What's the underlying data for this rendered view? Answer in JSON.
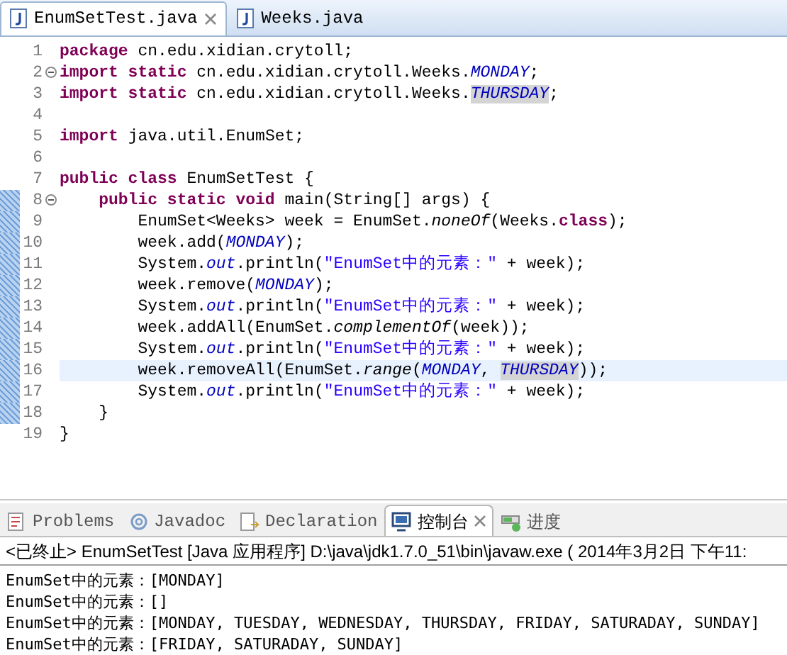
{
  "editor_tabs": [
    {
      "label": "EnumSetTest.java",
      "selected": true,
      "closable": true
    },
    {
      "label": "Weeks.java",
      "selected": false,
      "closable": false
    }
  ],
  "code_lines": [
    {
      "number": "1",
      "fold": false,
      "marked": false,
      "highlighted": false,
      "tokens": [
        {
          "kind": "keyword",
          "text": "package"
        },
        {
          "kind": "plain",
          "text": " cn.edu.xidian.crytoll;"
        }
      ]
    },
    {
      "number": "2",
      "fold": true,
      "marked": false,
      "highlighted": false,
      "tokens": [
        {
          "kind": "keyword",
          "text": "import static"
        },
        {
          "kind": "plain",
          "text": " cn.edu.xidian.crytoll.Weeks."
        },
        {
          "kind": "static_field",
          "text": "MONDAY"
        },
        {
          "kind": "plain",
          "text": ";"
        }
      ]
    },
    {
      "number": "3",
      "fold": false,
      "marked": false,
      "highlighted": false,
      "tokens": [
        {
          "kind": "keyword",
          "text": "import static"
        },
        {
          "kind": "plain",
          "text": " cn.edu.xidian.crytoll.Weeks."
        },
        {
          "kind": "occurrence",
          "text": "THURSDAY"
        },
        {
          "kind": "plain",
          "text": ";"
        }
      ]
    },
    {
      "number": "4",
      "fold": false,
      "marked": false,
      "highlighted": false
    },
    {
      "number": "5",
      "fold": false,
      "marked": false,
      "highlighted": false,
      "tokens": [
        {
          "kind": "keyword",
          "text": "import"
        },
        {
          "kind": "plain",
          "text": " java.util.EnumSet;"
        }
      ]
    },
    {
      "number": "6",
      "fold": false,
      "marked": false,
      "highlighted": false
    },
    {
      "number": "7",
      "fold": false,
      "marked": false,
      "highlighted": false,
      "tokens": [
        {
          "kind": "keyword",
          "text": "public class"
        },
        {
          "kind": "plain",
          "text": " EnumSetTest {"
        }
      ]
    },
    {
      "number": "8",
      "fold": true,
      "marked": true,
      "highlighted": false,
      "tokens": [
        {
          "kind": "keyword",
          "text": "    public static void"
        },
        {
          "kind": "plain",
          "text": " main(String[] args) {"
        }
      ]
    },
    {
      "number": "9",
      "fold": false,
      "marked": true,
      "highlighted": false,
      "tokens": [
        {
          "kind": "plain",
          "text": "        EnumSet<Weeks> week = EnumSet."
        },
        {
          "kind": "static_method",
          "text": "noneOf"
        },
        {
          "kind": "plain",
          "text": "(Weeks."
        },
        {
          "kind": "keyword",
          "text": "class"
        },
        {
          "kind": "plain",
          "text": ");"
        }
      ]
    },
    {
      "number": "10",
      "fold": false,
      "marked": true,
      "highlighted": false,
      "tokens": [
        {
          "kind": "plain",
          "text": "        week.add("
        },
        {
          "kind": "static_field",
          "text": "MONDAY"
        },
        {
          "kind": "plain",
          "text": ");"
        }
      ]
    },
    {
      "number": "11",
      "fold": false,
      "marked": true,
      "highlighted": false,
      "tokens": [
        {
          "kind": "plain",
          "text": "        System."
        },
        {
          "kind": "static_field",
          "text": "out"
        },
        {
          "kind": "plain",
          "text": ".println("
        },
        {
          "kind": "string",
          "text": "\"EnumSet中的元素：\""
        },
        {
          "kind": "plain",
          "text": " + week);"
        }
      ]
    },
    {
      "number": "12",
      "fold": false,
      "marked": true,
      "highlighted": false,
      "tokens": [
        {
          "kind": "plain",
          "text": "        week.remove("
        },
        {
          "kind": "static_field",
          "text": "MONDAY"
        },
        {
          "kind": "plain",
          "text": ");"
        }
      ]
    },
    {
      "number": "13",
      "fold": false,
      "marked": true,
      "highlighted": false,
      "tokens": [
        {
          "kind": "plain",
          "text": "        System."
        },
        {
          "kind": "static_field",
          "text": "out"
        },
        {
          "kind": "plain",
          "text": ".println("
        },
        {
          "kind": "string",
          "text": "\"EnumSet中的元素：\""
        },
        {
          "kind": "plain",
          "text": " + week);"
        }
      ]
    },
    {
      "number": "14",
      "fold": false,
      "marked": true,
      "highlighted": false,
      "tokens": [
        {
          "kind": "plain",
          "text": "        week.addAll(EnumSet."
        },
        {
          "kind": "static_method",
          "text": "complementOf"
        },
        {
          "kind": "plain",
          "text": "(week));"
        }
      ]
    },
    {
      "number": "15",
      "fold": false,
      "marked": true,
      "highlighted": false,
      "tokens": [
        {
          "kind": "plain",
          "text": "        System."
        },
        {
          "kind": "static_field",
          "text": "out"
        },
        {
          "kind": "plain",
          "text": ".println("
        },
        {
          "kind": "string",
          "text": "\"EnumSet中的元素：\""
        },
        {
          "kind": "plain",
          "text": " + week);"
        }
      ]
    },
    {
      "number": "16",
      "fold": false,
      "marked": true,
      "highlighted": true,
      "tokens": [
        {
          "kind": "plain",
          "text": "        week.removeAll(EnumSet."
        },
        {
          "kind": "static_method",
          "text": "range"
        },
        {
          "kind": "plain",
          "text": "("
        },
        {
          "kind": "static_field",
          "text": "MONDAY"
        },
        {
          "kind": "plain",
          "text": ", "
        },
        {
          "kind": "occurrence",
          "text": "THURSDAY"
        },
        {
          "kind": "plain",
          "text": "));"
        }
      ]
    },
    {
      "number": "17",
      "fold": false,
      "marked": true,
      "highlighted": false,
      "tokens": [
        {
          "kind": "plain",
          "text": "        System."
        },
        {
          "kind": "static_field",
          "text": "out"
        },
        {
          "kind": "plain",
          "text": ".println("
        },
        {
          "kind": "string",
          "text": "\"EnumSet中的元素：\""
        },
        {
          "kind": "plain",
          "text": " + week);"
        }
      ]
    },
    {
      "number": "18",
      "fold": false,
      "marked": true,
      "highlighted": false,
      "tokens": [
        {
          "kind": "plain",
          "text": "    }"
        }
      ]
    },
    {
      "number": "19",
      "fold": false,
      "marked": false,
      "highlighted": false,
      "tokens": [
        {
          "kind": "plain",
          "text": "}"
        }
      ]
    }
  ],
  "view_tabs": [
    {
      "kind": "problems",
      "label": "Problems",
      "selected": false,
      "closable": false
    },
    {
      "kind": "javadoc",
      "label": "Javadoc",
      "selected": false,
      "closable": false
    },
    {
      "kind": "declaration",
      "label": "Declaration",
      "selected": false,
      "closable": false
    },
    {
      "kind": "console",
      "label": "控制台",
      "selected": true,
      "closable": true
    },
    {
      "kind": "progress",
      "label": "进度",
      "selected": false,
      "closable": false
    }
  ],
  "console": {
    "header": "<已终止> EnumSetTest [Java 应用程序] D:\\java\\jdk1.7.0_51\\bin\\javaw.exe ( 2014年3月2日 下午11:",
    "lines": [
      "EnumSet中的元素：[MONDAY]",
      "EnumSet中的元素：[]",
      "EnumSet中的元素：[MONDAY, TUESDAY, WEDNESDAY, THURSDAY, FRIDAY, SATURADAY, SUNDAY]",
      "EnumSet中的元素：[FRIDAY, SATURADAY, SUNDAY]"
    ]
  }
}
